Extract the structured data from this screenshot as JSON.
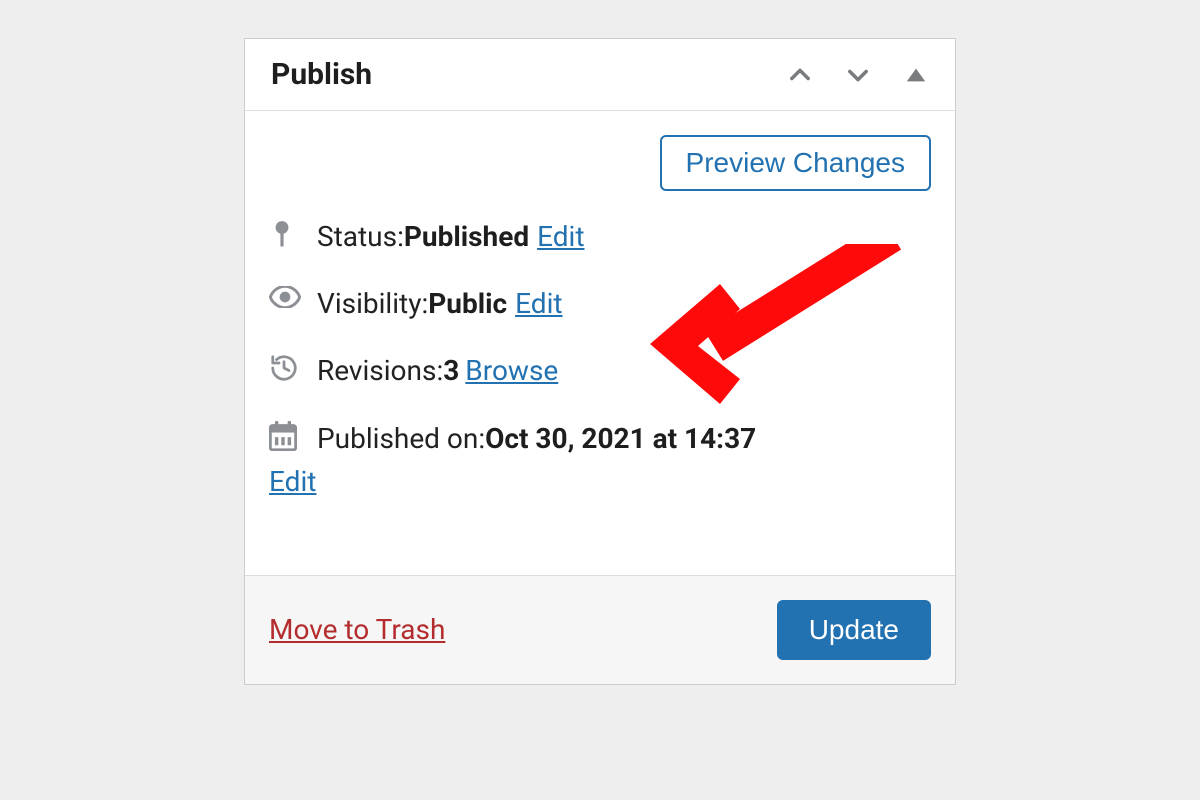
{
  "panel": {
    "title": "Publish",
    "preview_button": "Preview Changes",
    "status": {
      "label": "Status: ",
      "value": "Published",
      "edit": "Edit"
    },
    "visibility": {
      "label": "Visibility: ",
      "value": "Public",
      "edit": "Edit"
    },
    "revisions": {
      "label": "Revisions: ",
      "count": "3",
      "browse": "Browse"
    },
    "published": {
      "label": "Published on: ",
      "date": "Oct 30, 2021 at 14:37",
      "edit": "Edit"
    },
    "footer": {
      "trash": "Move to Trash",
      "update": "Update"
    }
  }
}
